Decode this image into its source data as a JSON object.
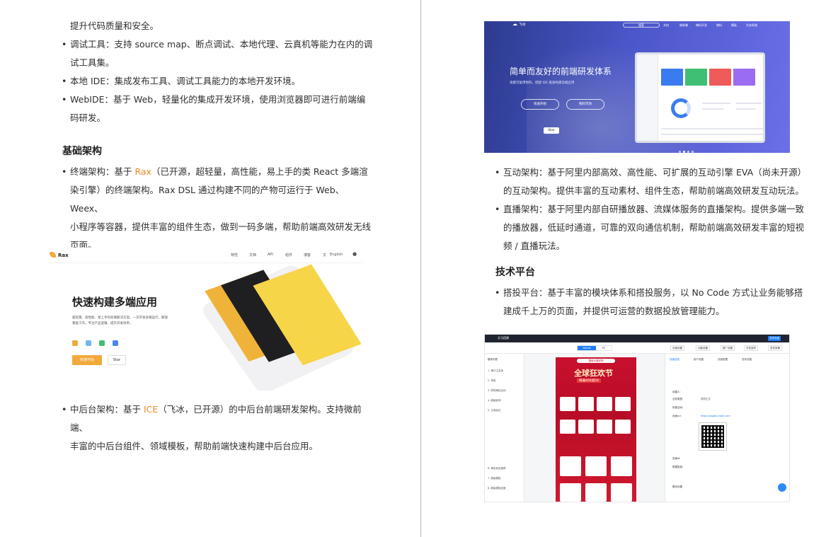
{
  "left": {
    "line_intro": "提升代码质量和安全。",
    "bullets_tools": [
      {
        "line1": "调试工具：支持 source map、断点调试、本地代理、云真机等能力在内的调",
        "line2": "试工具集。"
      },
      {
        "line1": "本地 IDE：集成发布工具、调试工具能力的本地开发环境。",
        "line2": ""
      },
      {
        "line1": "WebIDE：基于 Web，轻量化的集成开发环境，使用浏览器即可进行前端编",
        "line2": "码研发。"
      }
    ],
    "heading_infra": "基础架构",
    "bullet_rax": {
      "pre": "终端架构：基于 ",
      "hl": "Rax",
      "post": "（已开源，超轻量，高性能，易上手的类 React 多端渲",
      "line2": "染引擎）的终端架构。Rax DSL 通过构建不同的产物可运行于 Web、Weex、",
      "line3": "小程序等容器，提供丰富的组件生态，做到一码多端，帮助前端高效研发无线",
      "line4": "页面。"
    },
    "rax_screenshot": {
      "logo": "Rax",
      "nav": [
        "特性",
        "文档",
        "API",
        "组件",
        "博客",
        "English"
      ],
      "title": "快速构建多端应用",
      "desc1": "超轻量、高性能、易上手的前端解决方案。一次开发多端运行，解放",
      "desc2": "重复工作，专注产品逻辑，提升开发效率。",
      "btn_start": "快速开始",
      "btn_star": "Star"
    },
    "bullet_ice": {
      "pre": "中后台架构：基于 ",
      "hl": "ICE",
      "post": "（飞冰，已开源）的中后台前端研发架构。支持微前端、",
      "line2": "丰富的中后台组件、领域模板，帮助前端快速构建中后台应用。"
    }
  },
  "right": {
    "feibing_screenshot": {
      "logo": "飞冰",
      "search": "搜索",
      "nav": [
        "文档",
        "微前端",
        "物料开发",
        "物料",
        "模板",
        "生态系统"
      ],
      "title": "简单而友好的前端研发体系",
      "subtitle": "海量可复用物料，搭配 IDE 极速构建前端应用",
      "btn_start": "快速开始",
      "btn_market": "物料市场",
      "btn_star": "Star"
    },
    "bullet_interactive": {
      "line1": "互动架构：基于阿里内部高效、高性能、可扩展的互动引擎 EVA（尚未开源）",
      "line2": "的互动架构。提供丰富的互动素材、组件生态，帮助前端高效研发互动玩法。"
    },
    "bullet_live": {
      "line1": "直播架构：基于阿里内部自研播放器、流媒体服务的直播架构。提供多端一致",
      "line2": "的播放器，低延时通道，可靠的双向通信机制，帮助前端高效研发丰富的短视",
      "line3": "频 / 直播玩法。"
    },
    "heading_tech": "技术平台",
    "bullet_build": {
      "line1": "搭投平台：基于丰富的模块体系和搭投服务，以 No Code 方式让业务能够搭",
      "line2": "建成千上万的页面，并提供可运营的数据投放管理能力。"
    },
    "builder_screenshot": {
      "top_title": "天马搭建",
      "top_button": "发布页面",
      "seg_mobile": "Mobile",
      "seg_pc": "PC",
      "tools": [
        "页面设置",
        "功能设置",
        "推广设置",
        "开发选项",
        "发布效果"
      ],
      "left_header": "模块列表",
      "left_items": [
        "1. 黄灯主会场",
        "2. 导航",
        "3. 购物津贴活动",
        "4. 超级影响",
        "5. 大商品位",
        "6. 精彩商品推荐",
        "7. 超级模板",
        "8. 超级模板加度"
      ],
      "banner": "全球狂欢节",
      "banner_sub": "每满400减50",
      "phone_top": "搜索天猫好物",
      "right_tabs": [
        "页面信息",
        "用户设置",
        "页面配置",
        "发布设置"
      ],
      "fields": [
        "创建人:",
        "业务类型:",
        "所属活动:",
        "页面url:",
        "页面id:",
        "数据投放:"
      ],
      "field_values": [
        "",
        "导购正式",
        "",
        "https://pages.tmall.com",
        "",
        ""
      ],
      "section_basic": "基本设置"
    }
  }
}
